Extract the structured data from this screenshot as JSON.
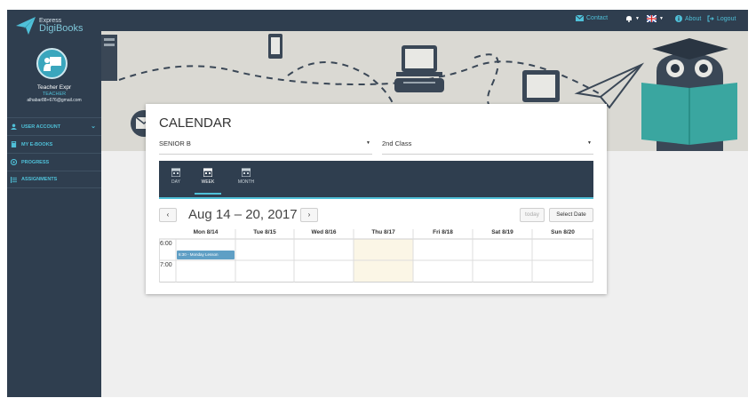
{
  "brand": {
    "small": "Express",
    "big": "DigiBooks"
  },
  "user": {
    "name": "Teacher Expr",
    "role": "TEACHER",
    "email": "alhabar88+676@gmail.com"
  },
  "sidebar": {
    "items": [
      {
        "label": "USER ACCOUNT",
        "icon": "user-icon"
      },
      {
        "label": "MY E-BOOKS",
        "icon": "book-icon"
      },
      {
        "label": "PROGRESS",
        "icon": "progress-icon"
      },
      {
        "label": "ASSIGNMENTS",
        "icon": "list-icon"
      }
    ]
  },
  "topbar": {
    "contact": "Contact",
    "about": "About",
    "logout": "Logout"
  },
  "calendar": {
    "title": "CALENDAR",
    "class_select": "SENIOR B",
    "group_select": "2nd Class",
    "views": [
      "DAY",
      "WEEK",
      "MONTH"
    ],
    "active_view": "WEEK",
    "date_range": "Aug 14 – 20, 2017",
    "prev": "‹",
    "next": "›",
    "today": "today",
    "select_date": "Select Date",
    "days": [
      "Mon 8/14",
      "Tue 8/15",
      "Wed 8/16",
      "Thu 8/17",
      "Fri 8/18",
      "Sat 8/19",
      "Sun 8/20"
    ],
    "times": [
      "6:00",
      "7:00"
    ],
    "event": "6:30 - Monday Lesson"
  },
  "colors": {
    "dark": "#2f3e4f",
    "accent": "#4fc0d8",
    "today": "#fbf6e6",
    "event": "#5f9fc5"
  }
}
